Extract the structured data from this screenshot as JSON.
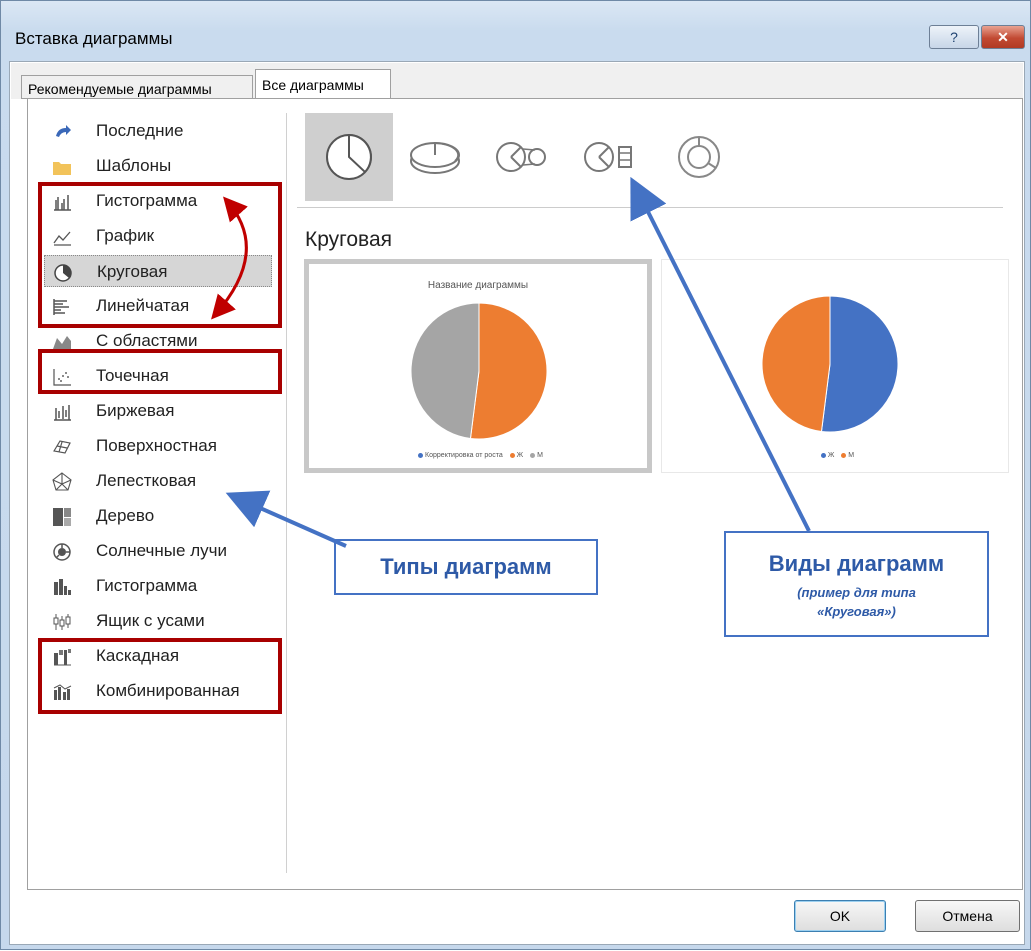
{
  "window": {
    "title": "Вставка диаграммы",
    "help_label": "?",
    "close_label": "✕"
  },
  "tabs": [
    {
      "label": "Рекомендуемые диаграммы",
      "active": false
    },
    {
      "label": "Все диаграммы",
      "active": true
    }
  ],
  "chart_types": [
    {
      "label": "Последние",
      "icon": "recent-icon"
    },
    {
      "label": "Шаблоны",
      "icon": "folder-icon"
    },
    {
      "label": "Гистограмма",
      "icon": "column-chart-icon"
    },
    {
      "label": "График",
      "icon": "line-chart-icon"
    },
    {
      "label": "Круговая",
      "icon": "pie-chart-icon",
      "selected": true
    },
    {
      "label": "Линейчатая",
      "icon": "bar-chart-icon"
    },
    {
      "label": "С областями",
      "icon": "area-chart-icon"
    },
    {
      "label": "Точечная",
      "icon": "scatter-chart-icon"
    },
    {
      "label": "Биржевая",
      "icon": "stock-chart-icon"
    },
    {
      "label": "Поверхностная",
      "icon": "surface-chart-icon"
    },
    {
      "label": "Лепестковая",
      "icon": "radar-chart-icon"
    },
    {
      "label": "Дерево",
      "icon": "treemap-chart-icon"
    },
    {
      "label": "Солнечные лучи",
      "icon": "sunburst-chart-icon"
    },
    {
      "label": "Гистограмма",
      "icon": "histogram-chart-icon"
    },
    {
      "label": "Ящик с усами",
      "icon": "box-whisker-chart-icon"
    },
    {
      "label": "Каскадная",
      "icon": "waterfall-chart-icon"
    },
    {
      "label": "Комбинированная",
      "icon": "combo-chart-icon"
    }
  ],
  "subtypes": [
    {
      "icon": "pie-subtype-icon",
      "selected": true
    },
    {
      "icon": "pie-3d-subtype-icon"
    },
    {
      "icon": "pie-of-pie-subtype-icon"
    },
    {
      "icon": "bar-of-pie-subtype-icon"
    },
    {
      "icon": "doughnut-subtype-icon"
    }
  ],
  "section_title": "Круговая",
  "previews": [
    {
      "chart_title": "Название диаграммы",
      "legend": [
        {
          "label": "Корректировка от роста",
          "color": "#4472c4"
        },
        {
          "label": "Ж",
          "color": "#ed7d31"
        },
        {
          "label": "М",
          "color": "#a5a5a5"
        }
      ]
    },
    {
      "legend": [
        {
          "label": "Ж",
          "color": "#4472c4"
        },
        {
          "label": "М",
          "color": "#ed7d31"
        }
      ]
    }
  ],
  "chart_data": [
    {
      "type": "pie",
      "title": "Название диаграммы",
      "categories": [
        "Корректировка от роста",
        "Ж",
        "М"
      ],
      "values": [
        0,
        52,
        48
      ],
      "colors": [
        "#4472c4",
        "#ed7d31",
        "#a5a5a5"
      ]
    },
    {
      "type": "pie",
      "title": "",
      "categories": [
        "Ж",
        "М"
      ],
      "values": [
        52,
        48
      ],
      "colors": [
        "#4472c4",
        "#ed7d31"
      ]
    }
  ],
  "callouts": {
    "types": {
      "text": "Типы диаграмм"
    },
    "kinds": {
      "text": "Виды диаграмм",
      "sub_line1": "(пример для типа",
      "sub_line2": "«Круговая»)"
    }
  },
  "annotation_colors": {
    "red_box": "#a80000",
    "blue_arrow": "#4472c4"
  },
  "buttons": {
    "ok": "OK",
    "cancel": "Отмена"
  }
}
